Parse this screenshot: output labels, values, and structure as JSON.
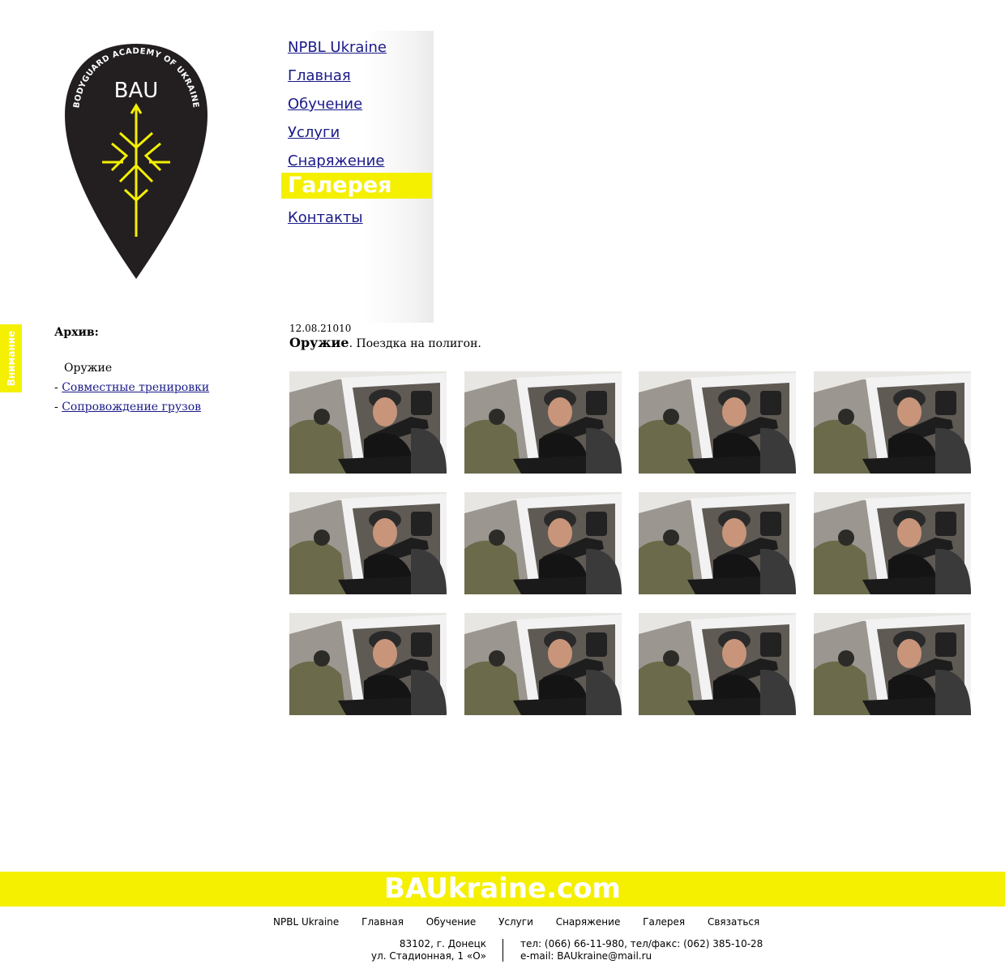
{
  "logo": {
    "text": "BAU",
    "ring_text": "BODYGUARD ACADEMY OF UKRAINE"
  },
  "nav": {
    "items": [
      {
        "label": "NPBL Ukraine"
      },
      {
        "label": "Главная"
      },
      {
        "label": "Обучение"
      },
      {
        "label": "Услуги"
      },
      {
        "label": "Снаряжение"
      },
      {
        "label": "Галерея"
      },
      {
        "label": "Контакты"
      }
    ],
    "active_index": 5
  },
  "attention_tab": {
    "label": "Внимание"
  },
  "archive": {
    "title": "Архив:",
    "current": "Оружие",
    "links": [
      "Совместные тренировки",
      "Сопровождение грузов"
    ]
  },
  "post": {
    "date": "12.08.21010",
    "category": "Оружие",
    "title": ". Поездка на полигон."
  },
  "gallery": {
    "columns": 4,
    "rows": 3
  },
  "footer": {
    "site": "BAUkraine.com",
    "nav": [
      "NPBL Ukraine",
      "Главная",
      "Обучение",
      "Услуги",
      "Снаряжение",
      "Галерея",
      "Связаться"
    ],
    "address_line1": "83102, г. Донецк",
    "address_line2": "ул. Стадионная, 1 «О»",
    "phone": "тел: (066) 66-11-980, тел/факс: (062) 385-10-28",
    "email": "e-mail: BAUkraine@mail.ru"
  },
  "colors": {
    "accent": "#f4f000",
    "link": "#1a1a8a",
    "logo_bg": "#231f20"
  }
}
